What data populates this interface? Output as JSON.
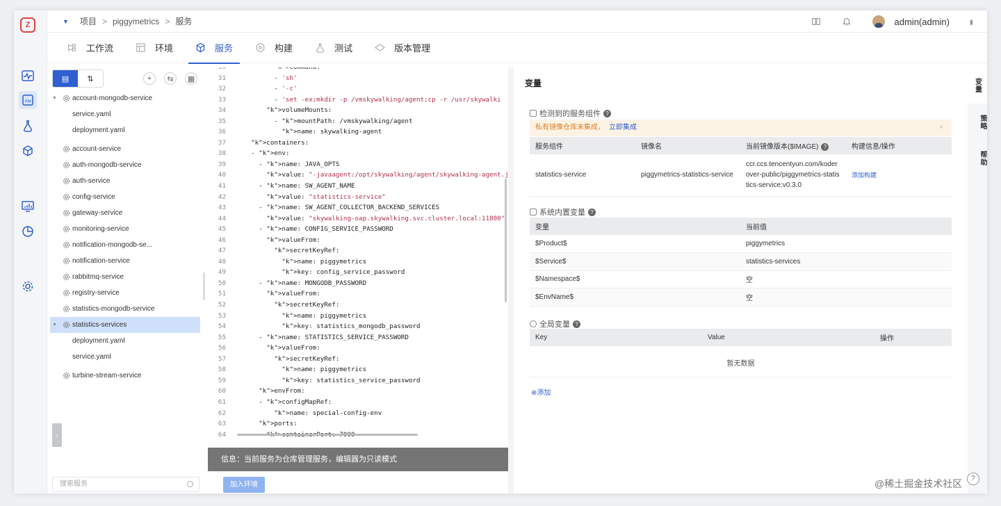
{
  "topbar": {
    "breadcrumb": [
      "项目",
      "piggymetrics",
      "服务"
    ],
    "user": "admin(admin)"
  },
  "tabs": [
    {
      "label": "工作流",
      "icon": "workflow-icon"
    },
    {
      "label": "环境",
      "icon": "environment-icon"
    },
    {
      "label": "服务",
      "icon": "service-cube-icon",
      "active": true
    },
    {
      "label": "构建",
      "icon": "build-icon"
    },
    {
      "label": "测试",
      "icon": "test-flask-icon"
    },
    {
      "label": "版本管理",
      "icon": "version-icon"
    }
  ],
  "tree": {
    "items": [
      {
        "label": "account-mongodb-service",
        "type": "service",
        "expanded": true
      },
      {
        "label": "service.yaml",
        "type": "file"
      },
      {
        "label": "deployment.yaml",
        "type": "file"
      },
      {
        "label": "account-service",
        "type": "service",
        "gap": true
      },
      {
        "label": "auth-mongodb-service",
        "type": "service"
      },
      {
        "label": "auth-service",
        "type": "service"
      },
      {
        "label": "config-service",
        "type": "service"
      },
      {
        "label": "gateway-service",
        "type": "service"
      },
      {
        "label": "monitoring-service",
        "type": "service"
      },
      {
        "label": "notification-mongodb-se...",
        "type": "service"
      },
      {
        "label": "notification-service",
        "type": "service"
      },
      {
        "label": "rabbitmq-service",
        "type": "service"
      },
      {
        "label": "registry-service",
        "type": "service"
      },
      {
        "label": "statistics-mongodb-service",
        "type": "service"
      },
      {
        "label": "statistics-services",
        "type": "service",
        "selected": true,
        "expanded": true
      },
      {
        "label": "deployment.yaml",
        "type": "file"
      },
      {
        "label": "service.yaml",
        "type": "file"
      },
      {
        "label": "turbine-stream-service",
        "type": "service",
        "gap": true
      }
    ],
    "search_placeholder": "搜索服务"
  },
  "code": {
    "lines": [
      {
        "n": "30",
        "t": "          command:"
      },
      {
        "n": "31",
        "t": "          - 'sh'"
      },
      {
        "n": "32",
        "t": "          - '-c'"
      },
      {
        "n": "33",
        "t": "          - 'set -ex;mkdir -p /vmskywalking/agent;cp -r /usr/skywalki"
      },
      {
        "n": "34",
        "t": "        volumeMounts:"
      },
      {
        "n": "35",
        "t": "          - mountPath: /vmskywalking/agent"
      },
      {
        "n": "36",
        "t": "            name: skywalking-agent"
      },
      {
        "n": "37",
        "t": "    containers:"
      },
      {
        "n": "38",
        "t": "    - env:"
      },
      {
        "n": "39",
        "t": "      - name: JAVA_OPTS"
      },
      {
        "n": "40",
        "t": "        value: \"-javaagent:/opt/skywalking/agent/skywalking-agent.jar"
      },
      {
        "n": "41",
        "t": "      - name: SW_AGENT_NAME"
      },
      {
        "n": "42",
        "t": "        value: \"statistics-service\""
      },
      {
        "n": "43",
        "t": "      - name: SW_AGENT_COLLECTOR_BACKEND_SERVICES"
      },
      {
        "n": "44",
        "t": "        value: \"skywalking-oap.skywalking.svc.cluster.local:11800\""
      },
      {
        "n": "45",
        "t": "      - name: CONFIG_SERVICE_PASSWORD"
      },
      {
        "n": "46",
        "t": "        valueFrom:"
      },
      {
        "n": "47",
        "t": "          secretKeyRef:"
      },
      {
        "n": "48",
        "t": "            name: piggymetrics"
      },
      {
        "n": "49",
        "t": "            key: config_service_password"
      },
      {
        "n": "50",
        "t": "      - name: MONGODB_PASSWORD"
      },
      {
        "n": "51",
        "t": "        valueFrom:"
      },
      {
        "n": "52",
        "t": "          secretKeyRef:"
      },
      {
        "n": "53",
        "t": "            name: piggymetrics"
      },
      {
        "n": "54",
        "t": "            key: statistics_mongodb_password"
      },
      {
        "n": "55",
        "t": "      - name: STATISTICS_SERVICE_PASSWORD"
      },
      {
        "n": "56",
        "t": "        valueFrom:"
      },
      {
        "n": "57",
        "t": "          secretKeyRef:"
      },
      {
        "n": "58",
        "t": "            name: piggymetrics"
      },
      {
        "n": "59",
        "t": "            key: statistics_service_password"
      },
      {
        "n": "60",
        "t": "      envFrom:"
      },
      {
        "n": "61",
        "t": "      - configMapRef:"
      },
      {
        "n": "62",
        "t": "          name: special-config-env"
      },
      {
        "n": "63",
        "t": "      ports:"
      },
      {
        "n": "64",
        "t": "      - containerPort: 7000"
      }
    ],
    "info": "信息：当前服务为仓库管理服务，编辑器为只读模式",
    "add_env_label": "加入环境"
  },
  "vars": {
    "title": "变量",
    "detected_title": "检测到的服务组件",
    "warning": "私有镜像仓库未集成，",
    "warning_link": "立即集成",
    "warning_close": "×",
    "comp_headers": [
      "服务组件",
      "镜像名",
      "当前镜像版本($IMAGE)",
      "构建信息/操作"
    ],
    "comp_row": {
      "component": "statistics-service",
      "image": "piggymetrics-statistics-service",
      "version": "ccr.ccs.tencentyun.com/koderover-public/piggymetrics-statistics-service:v0.3.0",
      "action": "添加构建"
    },
    "builtin_title": "系统内置变量",
    "builtin_headers": [
      "变量",
      "当前值"
    ],
    "builtin_rows": [
      [
        "$Product$",
        "piggymetrics"
      ],
      [
        "$Service$",
        "statistics-services"
      ],
      [
        "$Namespace$",
        "空"
      ],
      [
        "$EnvName$",
        "空"
      ]
    ],
    "global_title": "全局变量",
    "global_headers": [
      "Key",
      "Value",
      "操作"
    ],
    "no_data": "暂无数据",
    "add_label": "⊕添加"
  },
  "vtabs": [
    "变量",
    "策略",
    "帮助"
  ],
  "watermark": "@稀土掘金技术社区",
  "colors": {
    "accent": "#2f5fd0",
    "selected_row": "#cfe0fb",
    "warning_bg": "#fdf3e4"
  }
}
